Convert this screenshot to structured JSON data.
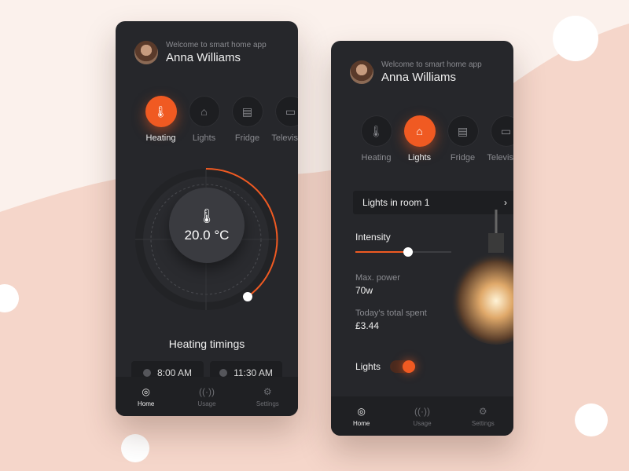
{
  "colors": {
    "accent": "#f05a22",
    "panel": "#26272b",
    "background": "#f9ece6"
  },
  "screen1": {
    "header": {
      "welcome": "Welcome to smart home app",
      "name": "Anna Williams"
    },
    "categories": [
      {
        "label": "Heating",
        "icon": "thermometer-icon",
        "active": true
      },
      {
        "label": "Lights",
        "icon": "lamp-icon",
        "active": false
      },
      {
        "label": "Fridge",
        "icon": "fridge-icon",
        "active": false
      },
      {
        "label": "Television",
        "icon": "tv-icon",
        "active": false
      }
    ],
    "thermostat": {
      "value": "20.0",
      "unit": "°C",
      "level_percent": 40
    },
    "timings_title": "Heating timings",
    "timings": [
      "8:00 AM",
      "11:30 AM"
    ],
    "nav": [
      {
        "label": "Home",
        "icon": "home-gauge-icon",
        "active": true
      },
      {
        "label": "Usage",
        "icon": "signal-icon",
        "active": false
      },
      {
        "label": "Settings",
        "icon": "gear-icon",
        "active": false
      }
    ]
  },
  "screen2": {
    "header": {
      "welcome": "Welcome to smart home app",
      "name": "Anna Williams"
    },
    "categories": [
      {
        "label": "Heating",
        "icon": "thermometer-icon",
        "active": false
      },
      {
        "label": "Lights",
        "icon": "lamp-icon",
        "active": true
      },
      {
        "label": "Fridge",
        "icon": "fridge-icon",
        "active": false
      },
      {
        "label": "Television",
        "icon": "tv-icon",
        "active": false
      }
    ],
    "room_selector": {
      "label": "Lights in room 1",
      "chevron": "›"
    },
    "intensity": {
      "label": "Intensity",
      "value_percent": 55
    },
    "max_power": {
      "label": "Max. power",
      "value": "70w"
    },
    "total_spent": {
      "label": "Today's total spent",
      "value": "£3.44"
    },
    "lights_toggle": {
      "label": "Lights",
      "on": true
    },
    "nav": [
      {
        "label": "Home",
        "icon": "home-gauge-icon",
        "active": true
      },
      {
        "label": "Usage",
        "icon": "signal-icon",
        "active": false
      },
      {
        "label": "Settings",
        "icon": "gear-icon",
        "active": false
      }
    ]
  }
}
